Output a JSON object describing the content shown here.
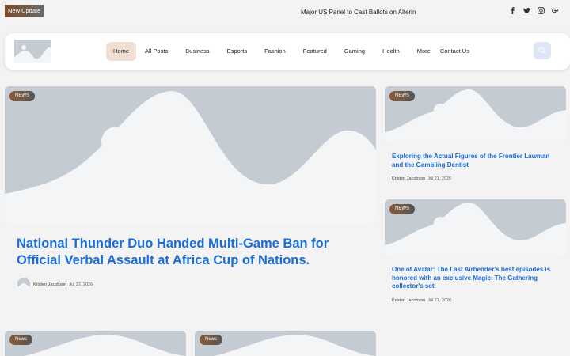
{
  "topbar": {
    "badge": "New Update",
    "ticker": "Major US Panel to Cast Ballots on Altering E",
    "socials": [
      "facebook-icon",
      "twitter-icon",
      "instagram-icon",
      "google-plus-icon"
    ]
  },
  "nav": {
    "items": [
      {
        "label": "Home",
        "active": true
      },
      {
        "label": "All Posts"
      },
      {
        "label": "Business"
      },
      {
        "label": "Esports"
      },
      {
        "label": "Fashion"
      },
      {
        "label": "Featured"
      },
      {
        "label": "Gaming"
      },
      {
        "label": "Health"
      },
      {
        "label": "More"
      },
      {
        "label": "Contact Us"
      }
    ]
  },
  "hero": {
    "tag": "NEWS",
    "title": "National Thunder Duo Handed Multi-Game Ban for Official Verbal Assault at Africa Cup of Nations.",
    "author": "Kristen Jacobson",
    "date": "Jul 22, 2026"
  },
  "side": [
    {
      "tag": "NEWS",
      "title": "Exploring the Actual Figures of the Frontier Lawman and the Gambling Dentist",
      "author": "Kristen Jacobson",
      "date": "Jul 21, 2026"
    },
    {
      "tag": "NEWS",
      "title": "One of Avatar: The Last Airbender's best episodes is honored with an exclusive Magic: The Gathering collector's set.",
      "author": "Kristen Jacobson",
      "date": "Jul 21, 2026"
    }
  ],
  "bottom": [
    {
      "tag": "News"
    },
    {
      "tag": "News"
    }
  ],
  "colors": {
    "accent": "#1a6cd6",
    "placeholder": "#c5cbd2",
    "active_nav": "#f1dfd4"
  }
}
